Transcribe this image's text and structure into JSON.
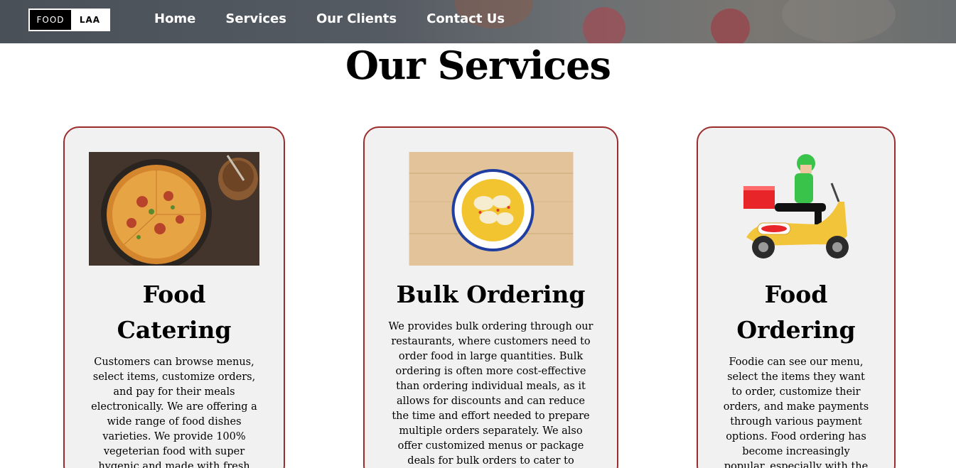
{
  "logo": {
    "left": "FOOD",
    "right": "LAA"
  },
  "nav": {
    "items": [
      {
        "label": "Home"
      },
      {
        "label": "Services"
      },
      {
        "label": "Our Clients"
      },
      {
        "label": "Contact Us"
      }
    ]
  },
  "main": {
    "title": "Our Services"
  },
  "cards": [
    {
      "title_line1": "Food",
      "title_line2": "Catering",
      "image": "pizza-photo",
      "text": "Customers can browse menus, select items, customize orders, and pay for their meals electronically. We are offering a wide range of food dishes varieties. We provide 100% vegeterian food with super hygenic and made with fresh"
    },
    {
      "title": "Bulk Ordering",
      "image": "bowl-dish-photo",
      "text": "We provides bulk ordering through our restaurants, where customers need to order food in large quantities. Bulk ordering is often more cost-effective than ordering individual meals, as it allows for discounts and can reduce the time and effort needed to prepare multiple orders separately. We also offer customized menus or package deals for bulk orders to cater to specific"
    },
    {
      "title_line1": "Food",
      "title_line2": "Ordering",
      "image": "delivery-scooter-illustration",
      "text": "Foodie can see our menu, select the items they want to order, customize their orders, and make payments through various payment options. Food ordering has become increasingly popular, especially with the"
    }
  ],
  "colors": {
    "card_border": "#9b2c2c",
    "card_bg": "#f1f1f1",
    "scooter_yellow": "#f2c43a",
    "rider_green": "#39c34a",
    "box_red": "#e8262a"
  }
}
